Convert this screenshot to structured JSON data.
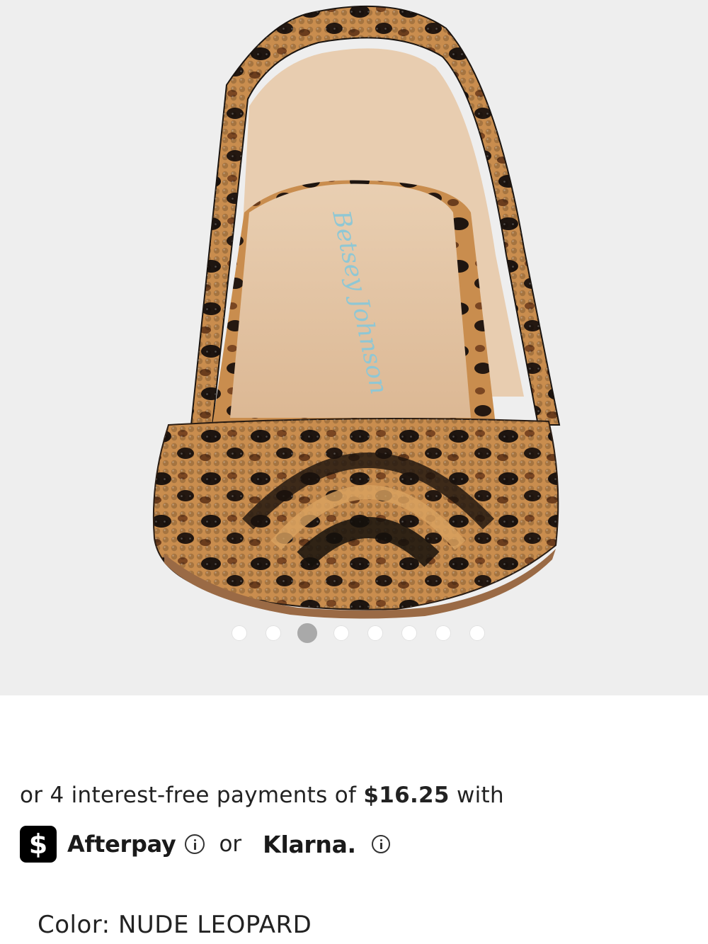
{
  "gallery": {
    "image_name": "leopard rhinestone slingback pump",
    "insole_brand_script": "Betsey Johnson",
    "dot_count": 8,
    "active_index": 2
  },
  "payment": {
    "prefix": "or 4 interest-free payments of ",
    "amount": "$16.25",
    "suffix": " with",
    "afterpay_badge": "$",
    "afterpay_label": "Afterpay",
    "or_text": "or",
    "klarna_label": "Klarna."
  },
  "product": {
    "color_label": "Color:",
    "color_value": "NUDE LEOPARD"
  },
  "colors": {
    "gallery_bg": "#eeeeee",
    "dot_active": "#a9a9a9",
    "dot_inactive": "#ffffff",
    "badge_bg": "#000000"
  },
  "icons": [
    "afterpay-logo-icon",
    "info-icon"
  ]
}
